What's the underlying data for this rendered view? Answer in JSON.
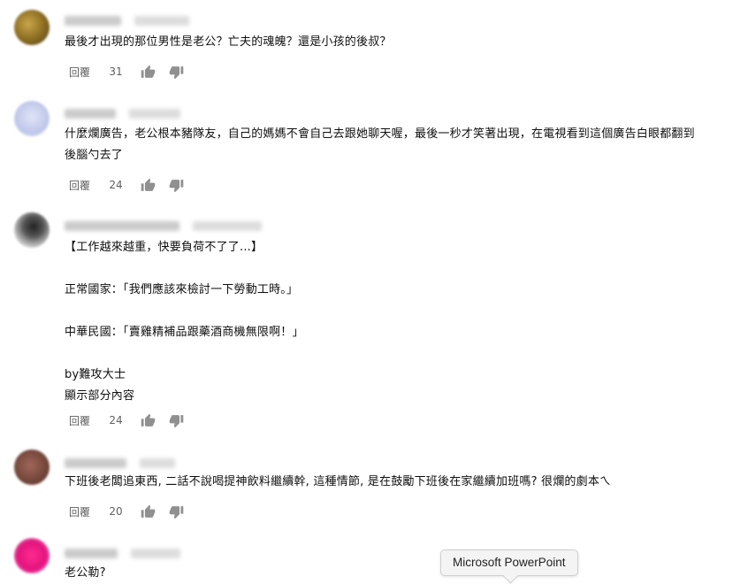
{
  "comments": [
    {
      "lines": [
        "最後才出現的那位男性是老公？亡夫的魂魄？還是小孩的後叔？"
      ],
      "reply": "回覆",
      "likes": "31",
      "avatar_color": "#9a7c2a"
    },
    {
      "lines": [
        "什麼爛廣告，老公根本豬隊友，自己的媽媽不會自己去跟她聊天喔，最後一秒才笑著出現，在電視看到這個廣告白眼都翻到",
        "後腦勺去了"
      ],
      "reply": "回覆",
      "likes": "24",
      "avatar_color": "#c5cce9"
    },
    {
      "lines": [
        "【工作越來越重，快要負荷不了了...】",
        "",
        "正常國家：「我們應該來檢討一下勞動工時。」",
        "",
        "中華民國：「賣雞精補品跟藥酒商機無限啊！」",
        "",
        "by難攻大士"
      ],
      "show_more": "顯示部分內容",
      "reply": "回覆",
      "likes": "24",
      "avatar_color": "#5a5a5a"
    },
    {
      "lines": [
        "下班後老闆追東西, 二話不說喝提神飲料繼續幹, 這種情節, 是在鼓勵下班後在家繼續加班嗎? 很爛的劇本ㄟ"
      ],
      "reply": "回覆",
      "likes": "20",
      "avatar_color": "#7a4a3e"
    },
    {
      "lines": [
        "老公勒?"
      ],
      "avatar_color": "#e3147f"
    }
  ],
  "tooltip": {
    "text": "Microsoft PowerPoint"
  },
  "icons": [
    "thumbs-up-icon",
    "thumbs-down-icon"
  ]
}
